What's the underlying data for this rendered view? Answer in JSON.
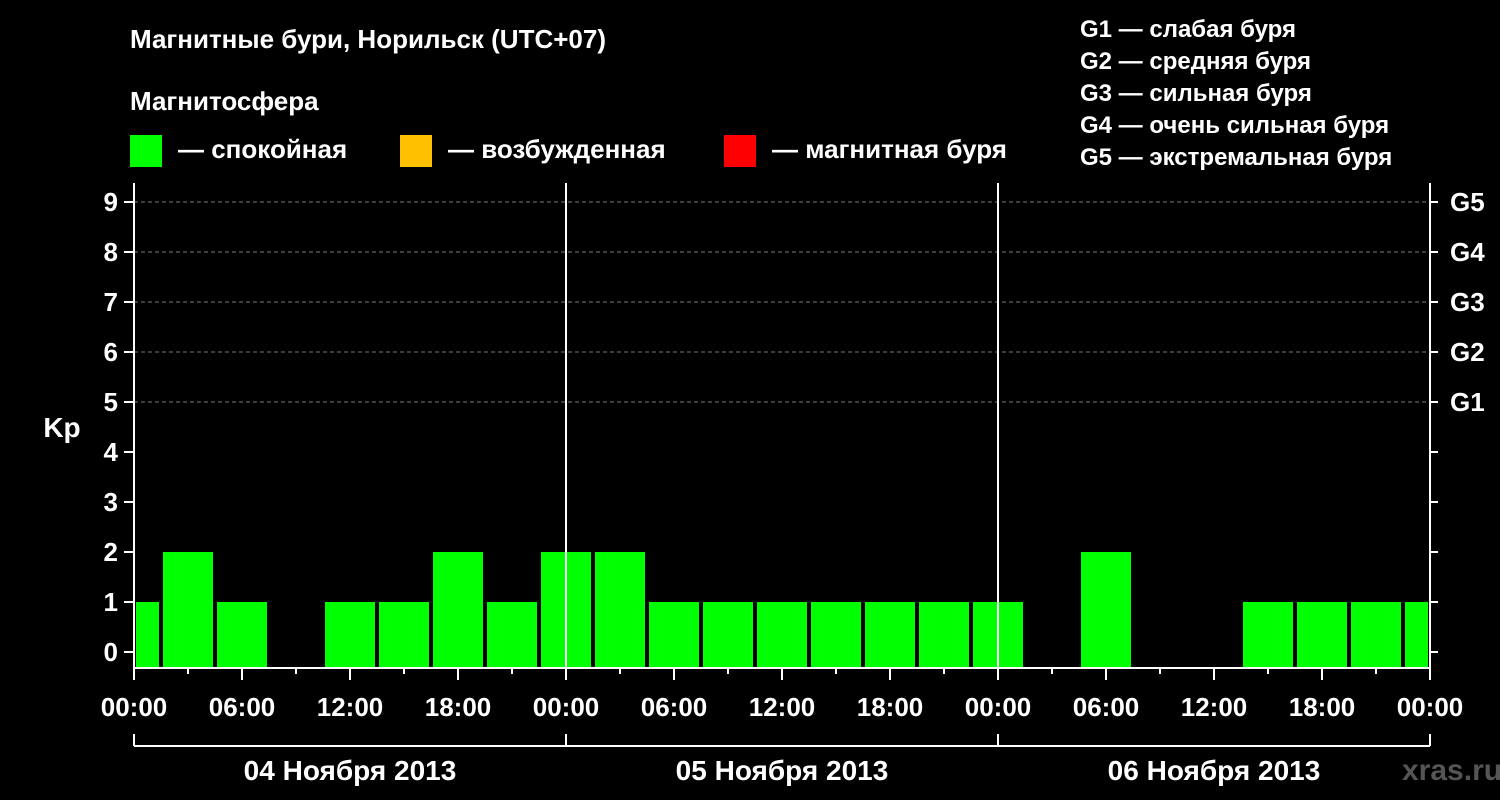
{
  "header": {
    "title": "Магнитные бури, Норильск (UTC+07)",
    "legend_title": "Магнитосфера",
    "legend": [
      {
        "label": "— спокойная",
        "color": "#00ff00"
      },
      {
        "label": "— возбужденная",
        "color": "#ffc000"
      },
      {
        "label": "— магнитная буря",
        "color": "#ff0000"
      }
    ],
    "storm_scale": [
      "G1 — слабая буря",
      "G2 — средняя буря",
      "G3 — сильная буря",
      "G4 — очень сильная буря",
      "G5 — экстремальная буря"
    ]
  },
  "watermark": "xras.ru",
  "chart_data": {
    "type": "bar",
    "ylabel": "Kp",
    "ylim": [
      0,
      9
    ],
    "y_ticks": [
      "0",
      "1",
      "2",
      "3",
      "4",
      "5",
      "6",
      "7",
      "8",
      "9"
    ],
    "right_ticks": [
      {
        "y": 5,
        "label": "G1"
      },
      {
        "y": 6,
        "label": "G2"
      },
      {
        "y": 7,
        "label": "G3"
      },
      {
        "y": 8,
        "label": "G4"
      },
      {
        "y": 9,
        "label": "G5"
      }
    ],
    "x_ticks": [
      "00:00",
      "06:00",
      "12:00",
      "18:00",
      "00:00",
      "06:00",
      "12:00",
      "18:00",
      "00:00",
      "06:00",
      "12:00",
      "18:00",
      "00:00"
    ],
    "dates": [
      "04 Ноября 2013",
      "05 Ноября 2013",
      "06 Ноября 2013"
    ],
    "x_unit": "hours from 04 Ноября 2013 00:00",
    "bars": [
      {
        "start": 0,
        "end": 1.5,
        "value": 1
      },
      {
        "start": 1.5,
        "end": 4.5,
        "value": 2
      },
      {
        "start": 4.5,
        "end": 7.5,
        "value": 1
      },
      {
        "start": 7.5,
        "end": 10.5,
        "value": 0
      },
      {
        "start": 10.5,
        "end": 13.5,
        "value": 1
      },
      {
        "start": 13.5,
        "end": 16.5,
        "value": 1
      },
      {
        "start": 16.5,
        "end": 19.5,
        "value": 2
      },
      {
        "start": 19.5,
        "end": 22.5,
        "value": 1
      },
      {
        "start": 22.5,
        "end": 25.5,
        "value": 2
      },
      {
        "start": 25.5,
        "end": 28.5,
        "value": 2
      },
      {
        "start": 28.5,
        "end": 31.5,
        "value": 1
      },
      {
        "start": 31.5,
        "end": 34.5,
        "value": 1
      },
      {
        "start": 34.5,
        "end": 37.5,
        "value": 1
      },
      {
        "start": 37.5,
        "end": 40.5,
        "value": 1
      },
      {
        "start": 40.5,
        "end": 43.5,
        "value": 1
      },
      {
        "start": 43.5,
        "end": 46.5,
        "value": 1
      },
      {
        "start": 46.5,
        "end": 49.5,
        "value": 1
      },
      {
        "start": 49.5,
        "end": 52.5,
        "value": 0
      },
      {
        "start": 52.5,
        "end": 55.5,
        "value": 2
      },
      {
        "start": 55.5,
        "end": 58.5,
        "value": 0
      },
      {
        "start": 58.5,
        "end": 61.5,
        "value": 0
      },
      {
        "start": 61.5,
        "end": 64.5,
        "value": 1
      },
      {
        "start": 64.5,
        "end": 67.5,
        "value": 1
      },
      {
        "start": 67.5,
        "end": 70.5,
        "value": 1
      },
      {
        "start": 70.5,
        "end": 72,
        "value": 1
      }
    ],
    "bar_color": "#00ff00",
    "grid": true
  }
}
